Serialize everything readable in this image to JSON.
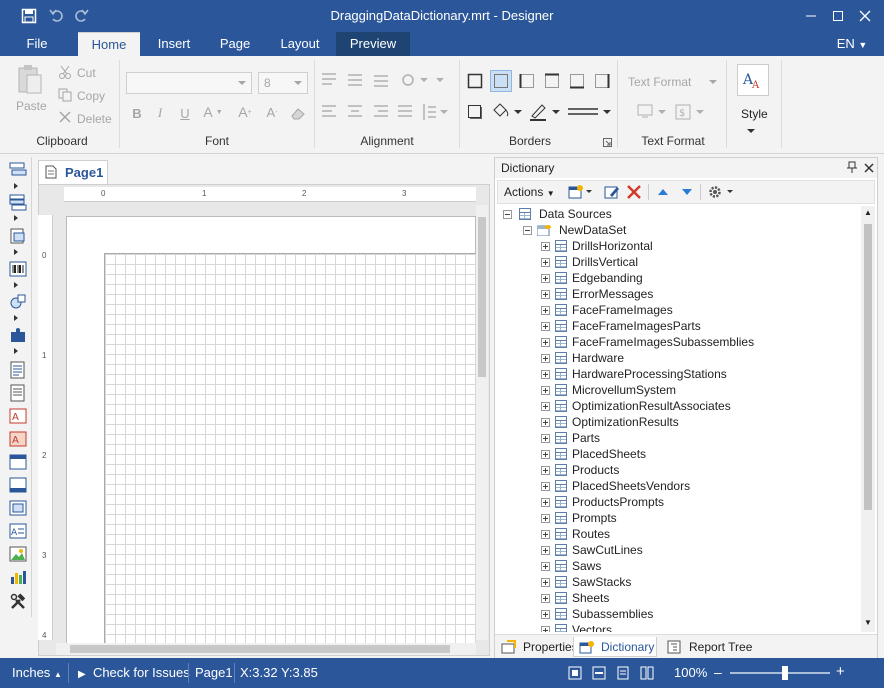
{
  "window": {
    "title": "DraggingDataDictionary.mrt - Designer"
  },
  "menu": {
    "tabs": [
      "File",
      "Home",
      "Insert",
      "Page",
      "Layout",
      "Preview"
    ],
    "language": "EN"
  },
  "ribbon": {
    "clipboard": {
      "title": "Clipboard",
      "paste": "Paste",
      "cut": "Cut",
      "copy": "Copy",
      "delete": "Delete"
    },
    "font": {
      "title": "Font",
      "font_name": "",
      "font_size": "8"
    },
    "alignment": {
      "title": "Alignment"
    },
    "borders": {
      "title": "Borders"
    },
    "text_format": {
      "title": "Text Format",
      "format_label": "Text Format"
    },
    "style": {
      "label": "Style"
    }
  },
  "page_tab": {
    "label": "Page1"
  },
  "ruler": {
    "h": [
      "0",
      "1",
      "2",
      "3"
    ],
    "v": [
      "0",
      "1",
      "2",
      "3",
      "4"
    ]
  },
  "dictionary": {
    "title": "Dictionary",
    "actions": "Actions",
    "root": "Data Sources",
    "dataset": "NewDataSet",
    "tables": [
      "DrillsHorizontal",
      "DrillsVertical",
      "Edgebanding",
      "ErrorMessages",
      "FaceFrameImages",
      "FaceFrameImagesParts",
      "FaceFrameImagesSubassemblies",
      "Hardware",
      "HardwareProcessingStations",
      "MicrovellumSystem",
      "OptimizationResultAssociates",
      "OptimizationResults",
      "Parts",
      "PlacedSheets",
      "Products",
      "PlacedSheetsVendors",
      "ProductsPrompts",
      "Prompts",
      "Routes",
      "SawCutLines",
      "Saws",
      "SawStacks",
      "Sheets",
      "Subassemblies",
      "Vectors"
    ],
    "bottom_tabs": [
      "Properties",
      "Dictionary",
      "Report Tree"
    ]
  },
  "status": {
    "units": "Inches",
    "check": "Check for Issues",
    "page": "Page1",
    "coords": "X:3.32 Y:3.85",
    "zoom": "100%"
  },
  "colors": {
    "accent": "#2b579a",
    "preview_tab": "#1e4474"
  }
}
